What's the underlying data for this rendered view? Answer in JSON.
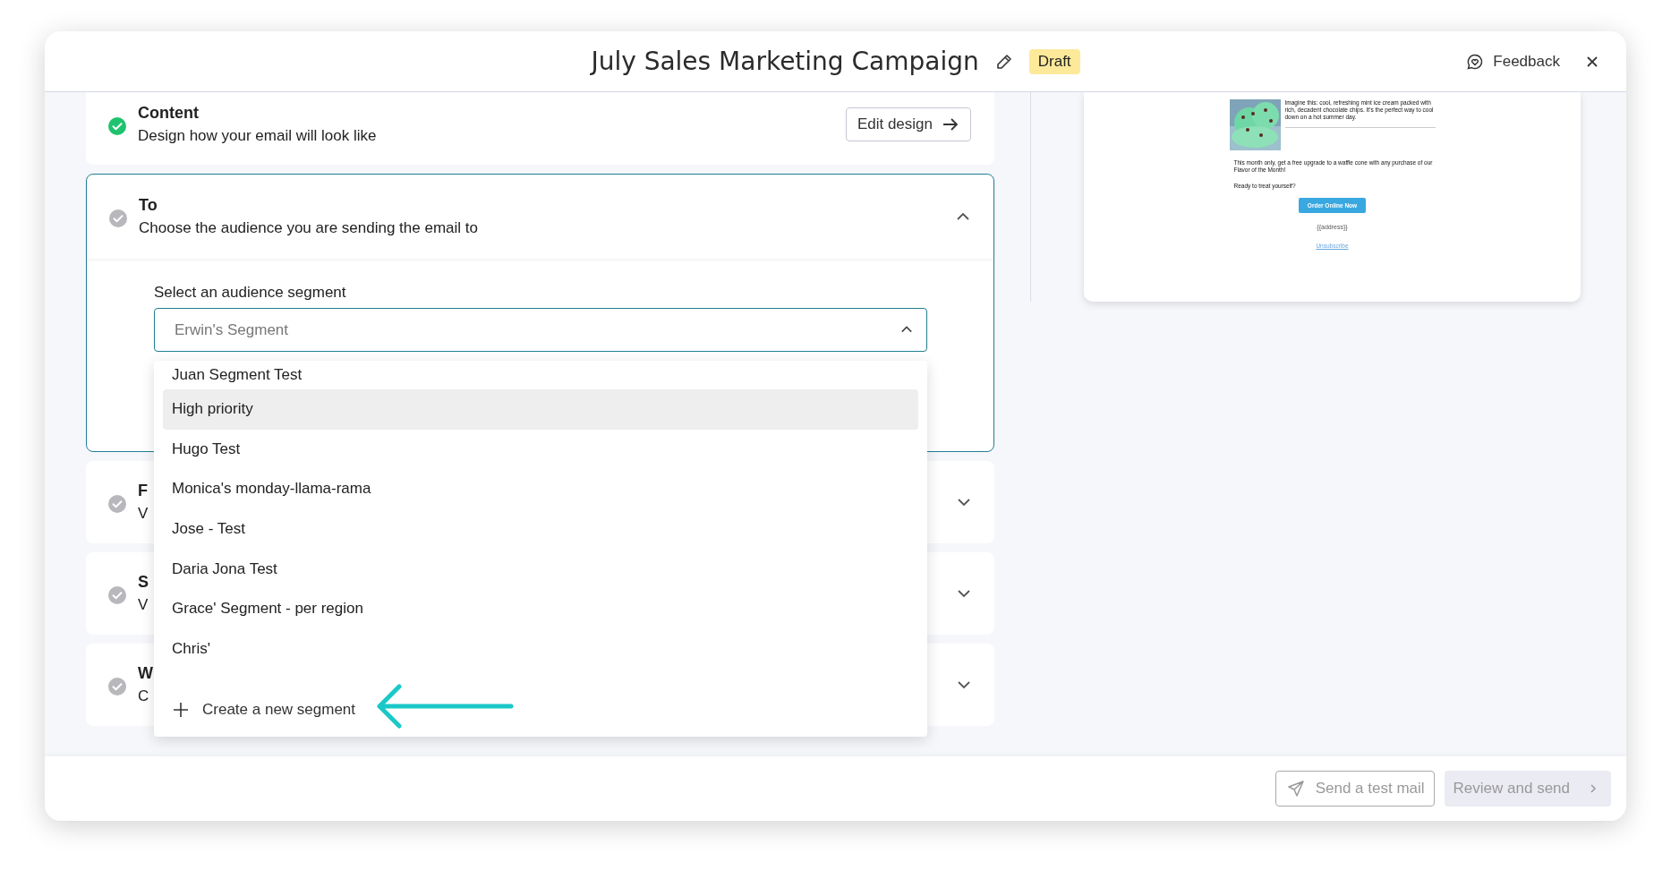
{
  "header": {
    "title": "July Sales Marketing Campaign",
    "status_badge": "Draft",
    "feedback": "Feedback"
  },
  "steps": [
    {
      "kind": "content",
      "title": "Content",
      "subtitle": "Design how your email will look like",
      "done": true,
      "action": "Edit design"
    },
    {
      "kind": "audience",
      "title": "To",
      "subtitle": "Choose the audience you are sending the email to",
      "done": false,
      "expanded": true
    },
    {
      "kind": "collapsed",
      "title": "F",
      "subtitle": "V",
      "done": false,
      "expanded": false
    },
    {
      "kind": "collapsed",
      "title": "S",
      "subtitle": "V",
      "done": false,
      "expanded": false
    },
    {
      "kind": "collapsed",
      "title": "W",
      "subtitle": "C",
      "done": false,
      "expanded": false
    }
  ],
  "audience": {
    "label": "Select an audience segment",
    "placeholder": "Erwin's Segment",
    "open": true,
    "options": [
      {
        "label": "Juan Segment Test",
        "selected": false
      },
      {
        "label": "High priority",
        "selected": true
      },
      {
        "label": "Hugo Test",
        "selected": false
      },
      {
        "label": "Monica's monday-llama-rama",
        "selected": false
      },
      {
        "label": "Jose - Test",
        "selected": false
      },
      {
        "label": "Daria Jona Test",
        "selected": false
      },
      {
        "label": "Grace' Segment - per region",
        "selected": false
      },
      {
        "label": "Chris'",
        "selected": false
      }
    ],
    "create": "Create a new segment"
  },
  "preview": {
    "intro": "Imagine this: cool, refreshing mint ice cream packed with rich, decadent chocolate chips. It's the perfect way to cool down on a hot summer day.",
    "offer": "This month only, get a free upgrade to a waffle cone with any purchase of our Flavor of the Month!",
    "question": "Ready to treat yourself?",
    "cta": "Order Online Now",
    "address": "{{address}}",
    "unsubscribe": "Unsubscribe"
  },
  "footer": {
    "test_button": "Send a test mail",
    "review_button": "Review and send"
  }
}
